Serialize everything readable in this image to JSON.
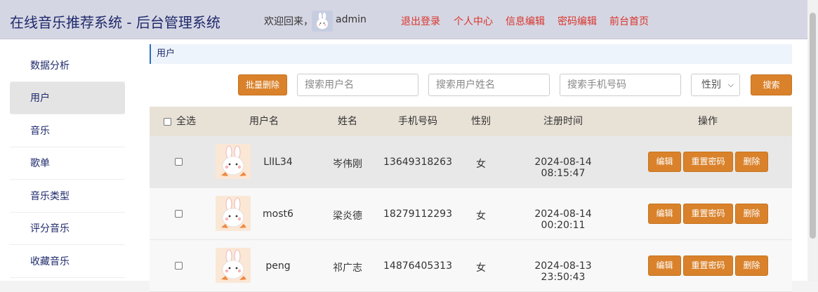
{
  "header": {
    "title": "在线音乐推荐系统 - 后台管理系统",
    "welcome": "欢迎回来，",
    "username": "admin",
    "links": [
      "退出登录",
      "个人中心",
      "信息编辑",
      "密码编辑",
      "前台首页"
    ]
  },
  "sidebar": {
    "items": [
      {
        "label": "数据分析"
      },
      {
        "label": "用户"
      },
      {
        "label": "音乐"
      },
      {
        "label": "歌单"
      },
      {
        "label": "音乐类型"
      },
      {
        "label": "评分音乐"
      },
      {
        "label": "收藏音乐"
      }
    ],
    "active_index": 1
  },
  "breadcrumb": "用户",
  "toolbar": {
    "batch_delete": "批量删除",
    "search_username_placeholder": "搜索用户名",
    "search_name_placeholder": "搜索用户姓名",
    "search_phone_placeholder": "搜索手机号码",
    "gender_select": "性别",
    "search_button": "搜索"
  },
  "table": {
    "headers": {
      "select_all": "全选",
      "username": "用户名",
      "name": "姓名",
      "phone": "手机号码",
      "gender": "性别",
      "registered": "注册时间",
      "actions": "操作"
    },
    "rows": [
      {
        "username": "LlIL34",
        "name": "岑伟刚",
        "phone": "13649318263",
        "gender": "女",
        "registered": "2024-08-14 08:15:47"
      },
      {
        "username": "most6",
        "name": "梁炎德",
        "phone": "18279112293",
        "gender": "女",
        "registered": "2024-08-14 00:20:11"
      },
      {
        "username": "peng",
        "name": "祁广志",
        "phone": "14876405313",
        "gender": "女",
        "registered": "2024-08-13 23:50:43"
      }
    ],
    "row_actions": {
      "edit": "编辑",
      "reset_password": "重置密码",
      "delete": "删除"
    }
  },
  "colors": {
    "accent": "#d9822b",
    "link_red": "#d9342b",
    "title_navy": "#1f2a6b",
    "header_bg": "#d5d6e3",
    "table_head_bg": "#e8e1d6"
  }
}
